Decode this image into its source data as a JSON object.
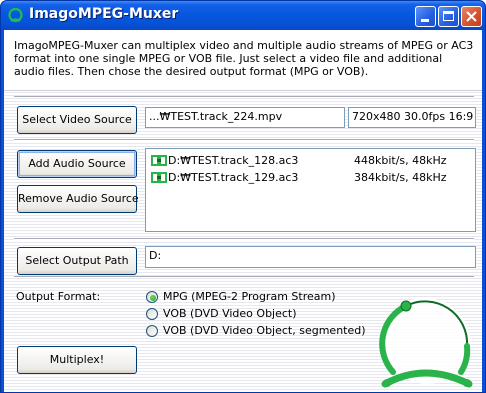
{
  "window": {
    "title": "ImagoMPEG-Muxer"
  },
  "description": "ImagoMPEG-Muxer can multiplex video and multiple audio streams of MPEG or AC3 format into one single MPEG or VOB file. Just select a video file and additional audio files. Then chose the desired output format (MPG or VOB).",
  "video": {
    "button_label": "Select Video Source",
    "path": "...₩TEST.track_224.mpv",
    "info": "720x480 30.0fps 16:9"
  },
  "audio": {
    "add_label": "Add Audio Source",
    "remove_label": "Remove Audio Source",
    "items": [
      {
        "file": "D:₩TEST.track_128.ac3",
        "info": "448kbit/s, 48kHz",
        "icon": "ac3-audio-icon"
      },
      {
        "file": "D:₩TEST.track_129.ac3",
        "info": "384kbit/s, 48kHz",
        "icon": "ac3-audio-icon"
      }
    ]
  },
  "output": {
    "button_label": "Select Output Path",
    "path": "D:",
    "format_label": "Output Format:",
    "formats": [
      {
        "label": "MPG (MPEG-2 Program Stream)",
        "selected": true
      },
      {
        "label": "VOB (DVD Video Object)",
        "selected": false
      },
      {
        "label": "VOB (DVD Video Object, segmented)",
        "selected": false
      }
    ]
  },
  "multiplex_label": "Multiplex!",
  "colors": {
    "title_bar": "#0553d6",
    "close_button": "#d5502c",
    "accent_green": "#2ab34a",
    "radio_selected": "#21a121"
  }
}
